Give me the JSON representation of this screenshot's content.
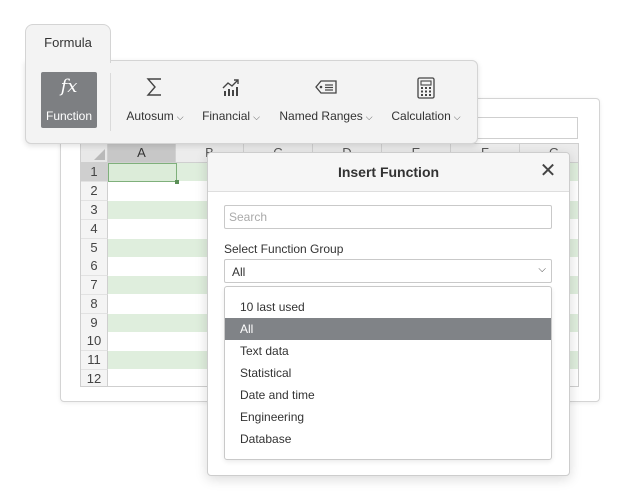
{
  "ribbon": {
    "tab_label": "Formula",
    "buttons": [
      {
        "label": "Function",
        "icon": "fx-icon",
        "glyph": "fx"
      },
      {
        "label": "Autosum",
        "icon": "sigma-icon",
        "glyph": "∑"
      },
      {
        "label": "Financial",
        "icon": "financial-chart-icon"
      },
      {
        "label": "Named Ranges",
        "icon": "tag-icon"
      },
      {
        "label": "Calculation",
        "icon": "calculator-icon"
      }
    ]
  },
  "sheet": {
    "columns": [
      "A",
      "B",
      "C",
      "D",
      "E",
      "F",
      "G"
    ],
    "rows": [
      "1",
      "2",
      "3",
      "4",
      "5",
      "6",
      "7",
      "8",
      "9",
      "10",
      "11",
      "12"
    ],
    "selected_cell": "A1",
    "band_color": "#dfeedd"
  },
  "dialog": {
    "title": "Insert Function",
    "search_placeholder": "Search",
    "group_label": "Select Function Group",
    "group_value": "All",
    "options": [
      "10 last used",
      "All",
      "Text data",
      "Statistical",
      "Date and time",
      "Engineering",
      "Database"
    ],
    "selected_option": "All",
    "selected_color": "#808387"
  }
}
